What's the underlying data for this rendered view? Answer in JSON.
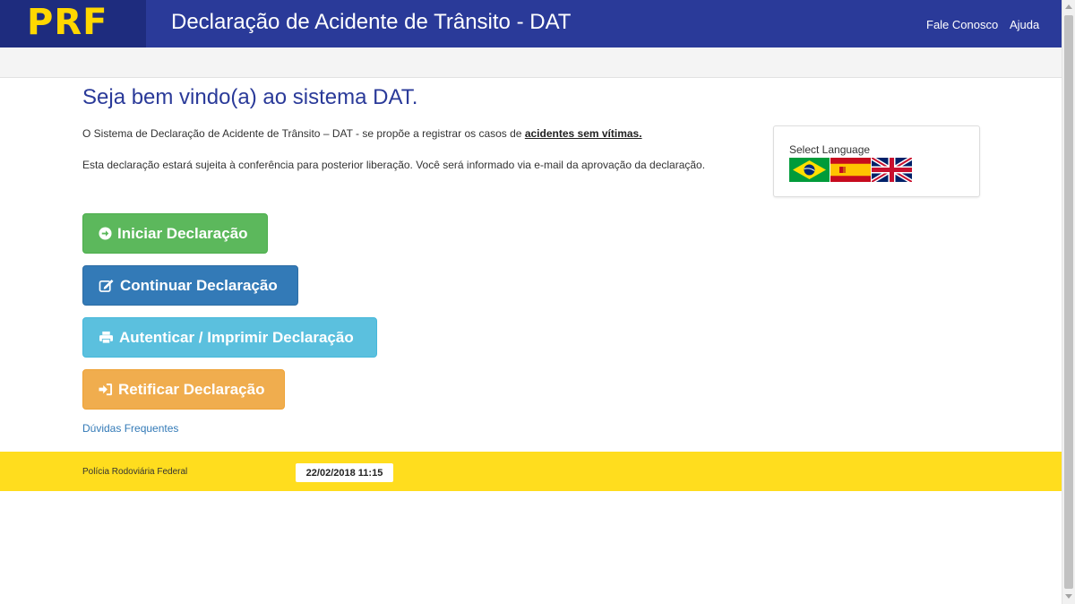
{
  "header": {
    "logo": "PRF",
    "title": "Declaração de Acidente de Trânsito - DAT",
    "nav": [
      "Fale Conosco",
      "Ajuda"
    ]
  },
  "main": {
    "welcome": "Seja bem vindo(a) ao sistema DAT.",
    "intro_text": "O Sistema de Declaração de Acidente de Trânsito – DAT - se propõe a registrar os casos de",
    "intro_highlight": "acidentes sem vítimas.",
    "notice": "Esta declaração estará sujeita à conferência para posterior liberação. Você será informado via e-mail da aprovação da declaração.",
    "buttons": [
      {
        "label": "Iniciar Declaração",
        "icon": "arrow-circle-right-icon",
        "color": "#5cb85c"
      },
      {
        "label": "Continuar Declaração",
        "icon": "edit-icon",
        "color": "#337ab7"
      },
      {
        "label": "Autenticar / Imprimir Declaração",
        "icon": "print-icon",
        "color": "#5bc0de"
      },
      {
        "label": "Retificar Declaração",
        "icon": "sign-in-icon",
        "color": "#f0ad4e"
      }
    ],
    "faq_link": "Dúvidas Frequentes"
  },
  "language": {
    "label": "Select Language",
    "flags": [
      "brazil-flag-icon",
      "spain-flag-icon",
      "uk-flag-icon"
    ]
  },
  "footer": {
    "org": "Polícia Rodoviária Federal",
    "datetime": "22/02/2018 11:15"
  },
  "colors": {
    "header_bg": "#2a3a99",
    "logo_bg": "#1e2c7e",
    "logo_text": "#ffd700",
    "footer_bg": "#ffdd1e"
  }
}
